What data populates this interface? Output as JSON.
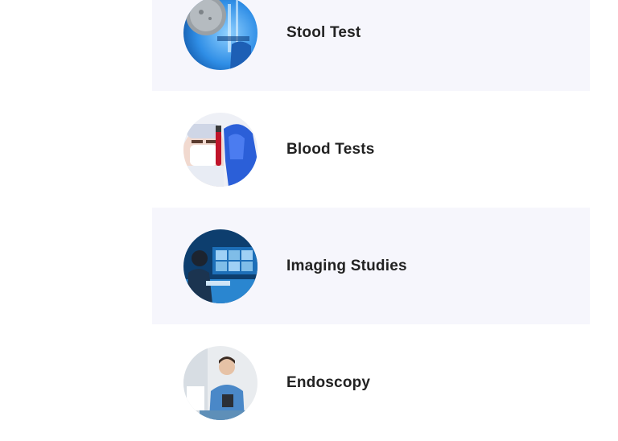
{
  "test_list": {
    "items": [
      {
        "label": "Stool Test",
        "thumbnail": "lab-technician-photo"
      },
      {
        "label": "Blood Tests",
        "thumbnail": "blood-sample-photo"
      },
      {
        "label": "Imaging Studies",
        "thumbnail": "radiology-workstation-photo"
      },
      {
        "label": "Endoscopy",
        "thumbnail": "doctor-endoscopy-photo"
      }
    ]
  },
  "colors": {
    "row_shaded": "#f6f6fc",
    "row_plain": "#ffffff",
    "label_text": "#222222"
  }
}
